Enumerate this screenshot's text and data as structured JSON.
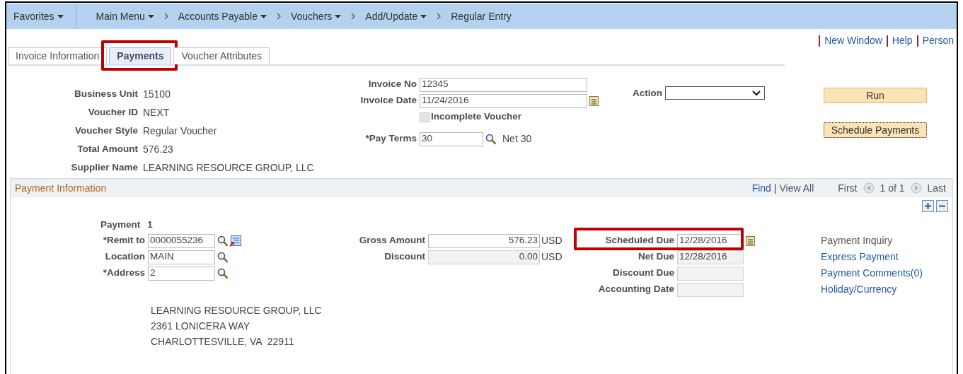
{
  "menu_bar": {
    "items": [
      {
        "label": "Favorites",
        "dropdown": true
      },
      {
        "label": "Main Menu",
        "dropdown": true
      },
      {
        "label": "Accounts Payable",
        "dropdown": true
      },
      {
        "label": "Vouchers",
        "dropdown": true
      },
      {
        "label": "Add/Update",
        "dropdown": true
      },
      {
        "label": "Regular Entry",
        "dropdown": false
      }
    ]
  },
  "header_links": [
    "New Window",
    "Help",
    "Person"
  ],
  "tabs": [
    {
      "label": "Invoice Information",
      "selected": false,
      "highlighted": false
    },
    {
      "label": "Payments",
      "selected": true,
      "highlighted": true
    },
    {
      "label": "Voucher Attributes",
      "selected": false,
      "highlighted": false
    }
  ],
  "voucher_info": [
    {
      "label": "Business Unit",
      "value": "15100"
    },
    {
      "label": "Voucher ID",
      "value": "NEXT"
    },
    {
      "label": "Voucher Style",
      "value": "Regular Voucher"
    },
    {
      "label": "Total Amount",
      "value": "576.23"
    },
    {
      "label": "Supplier Name",
      "value": "LEARNING RESOURCE GROUP, LLC"
    }
  ],
  "invoice_fields": [
    {
      "label": "Invoice No",
      "value": "12345",
      "kind": "plain"
    },
    {
      "label": "Invoice Date",
      "value": "11/24/2016",
      "kind": "date"
    },
    {
      "label": "Incomplete Voucher",
      "kind": "checkbox",
      "checked": false,
      "disabled": true
    },
    {
      "label": "*Pay Terms",
      "value": "30",
      "kind": "lookup",
      "description": "Net 30"
    }
  ],
  "action": {
    "label": "Action"
  },
  "buttons": [
    {
      "label": "Run",
      "focused": false
    },
    {
      "label": "Schedule Payments",
      "focused": true
    }
  ],
  "payment_panel": {
    "title": "Payment Information",
    "nav": {
      "find": "Find",
      "separator": "|",
      "view_all": "View All",
      "first": "First",
      "count": "1 of 1",
      "last": "Last"
    },
    "payment_label": "Payment",
    "payment_number": "1",
    "remit_fields": [
      {
        "label": "*Remit to",
        "value": "0000055236",
        "kind": "lookup_detail"
      },
      {
        "label": "Location",
        "value": "MAIN",
        "kind": "lookup"
      },
      {
        "label": "*Address",
        "value": "2",
        "kind": "lookup"
      }
    ],
    "amount_fields": [
      {
        "label": "Gross Amount",
        "value": "576.23",
        "currency": "USD",
        "readonly": false
      },
      {
        "label": "Discount",
        "value": "0.00",
        "currency": "USD",
        "readonly": true
      }
    ],
    "date_fields": [
      {
        "label": "Scheduled Due",
        "value": "12/28/2016",
        "readonly": false,
        "highlighted": true
      },
      {
        "label": "Net Due",
        "value": "12/28/2016",
        "readonly": true,
        "highlighted": false
      },
      {
        "label": "Discount Due",
        "readonly": true,
        "highlighted": false
      },
      {
        "label": "Accounting Date",
        "readonly": true,
        "highlighted": false
      }
    ],
    "links": [
      {
        "label": "Payment Inquiry",
        "disabled": true
      },
      {
        "label": "Express Payment",
        "disabled": false
      },
      {
        "label": "Payment Comments(0)",
        "disabled": false
      },
      {
        "label": "Holiday/Currency",
        "disabled": false
      }
    ],
    "address": [
      "LEARNING RESOURCE GROUP, LLC",
      "2361 LONICERA WAY",
      "CHARLOTTESVILLE, VA  22911"
    ]
  }
}
